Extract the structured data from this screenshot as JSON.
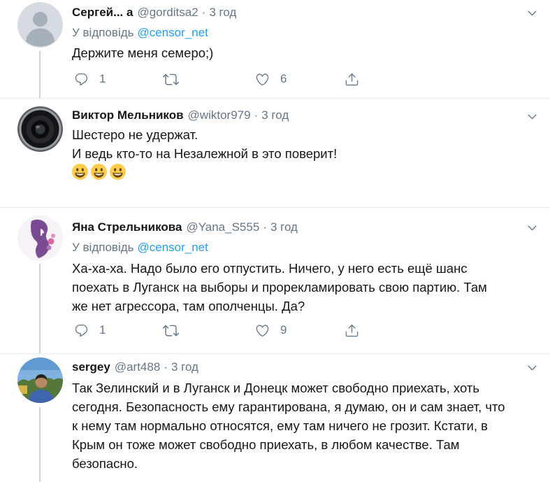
{
  "theme": {
    "text_color": "#14171a",
    "secondary_text_color": "#657786",
    "link_color": "#1da1f2",
    "divider_color": "#e6ecf0"
  },
  "icons": {
    "reply": "reply-icon",
    "retweet": "retweet-icon",
    "like": "heart-icon",
    "share": "share-icon",
    "more": "chevron-down-icon"
  },
  "tweets": [
    {
      "name": "Сергей... а",
      "handle": "@gorditsa2",
      "separator": "·",
      "time": "3 год",
      "reply_prefix": "У відповідь",
      "reply_to": "@censor_net",
      "lines": [
        "Держите меня семеро;)"
      ],
      "reply_count": "1",
      "like_count": "6"
    },
    {
      "name": "Виктор Мельников",
      "handle": "@wiktor979",
      "separator": "·",
      "time": "3 год",
      "lines": [
        "Шестеро не удержат.",
        "И ведь кто-то на Незалежной в это поверит!"
      ],
      "emojis": [
        "grinning-face-icon",
        "grinning-face-icon",
        "grinning-face-icon"
      ]
    },
    {
      "name": "Яна Стрельникова",
      "handle": "@Yana_S555",
      "separator": "·",
      "time": "3 год",
      "reply_prefix": "У відповідь",
      "reply_to": "@censor_net",
      "lines": [
        "Ха-ха-ха. Надо было его отпустить. Ничего, у него есть ещё шанс",
        "поехать в Луганск на выборы и прорекламировать свою партию. Там",
        "же нет агрессора, там ополченцы. Да?"
      ],
      "reply_count": "1",
      "like_count": "9"
    },
    {
      "name": "sergey",
      "handle": "@art488",
      "separator": "·",
      "time": "3 год",
      "lines": [
        "Так Зелинский и в Луганск и Донецк может свободно приехать, хоть",
        "сегодня. Безопасность ему гарантирована, я думаю, он и сам знает, что",
        "к нему там нормально относятся, ему там ничего не грозит. Кстати, в",
        "Крым он тоже может свободно приехать, в любом качестве. Там",
        "безопасно."
      ]
    }
  ]
}
